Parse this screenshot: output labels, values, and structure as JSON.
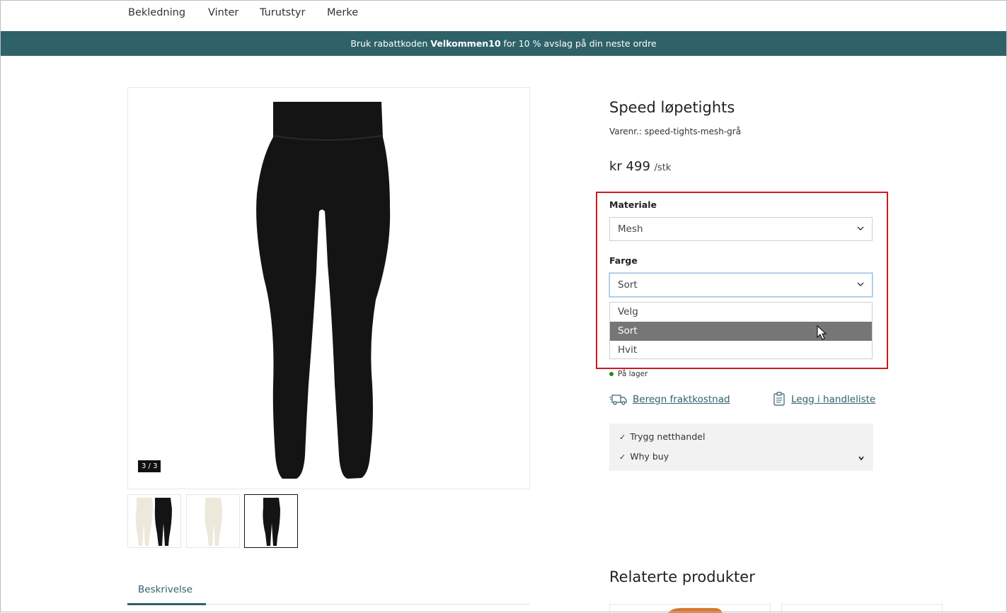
{
  "nav": {
    "items": [
      "Bekledning",
      "Vinter",
      "Turutstyr",
      "Merke"
    ]
  },
  "banner": {
    "before": "Bruk rabattkoden",
    "code": "Velkommen10",
    "after": "for 10 % avslag på din neste ordre"
  },
  "gallery": {
    "counter": "3 / 3",
    "thumbnails": 3,
    "active_index": 2
  },
  "product": {
    "title": "Speed løpetights",
    "sku": "Varenr.: speed-tights-mesh-grå",
    "price": "kr 499",
    "unit": "/stk"
  },
  "options": {
    "material_label": "Materiale",
    "material_value": "Mesh",
    "color_label": "Farge",
    "color_value": "Sort",
    "color_options": [
      "Velg",
      "Sort",
      "Hvit"
    ],
    "color_highlighted": "Sort"
  },
  "stock": {
    "text": "På lager",
    "color": "#1e8a1e"
  },
  "links": {
    "shipping": "Beregn fraktkostnad",
    "list": "Legg i handleliste"
  },
  "benefits": {
    "items": [
      "Trygg netthandel",
      "Why buy"
    ]
  },
  "tabs": {
    "description": "Beskrivelse"
  },
  "related": {
    "title": "Relaterte produkter"
  },
  "colors": {
    "accent": "#2f6169",
    "highlight_border": "#d0191f",
    "selected_option": "#767676"
  }
}
